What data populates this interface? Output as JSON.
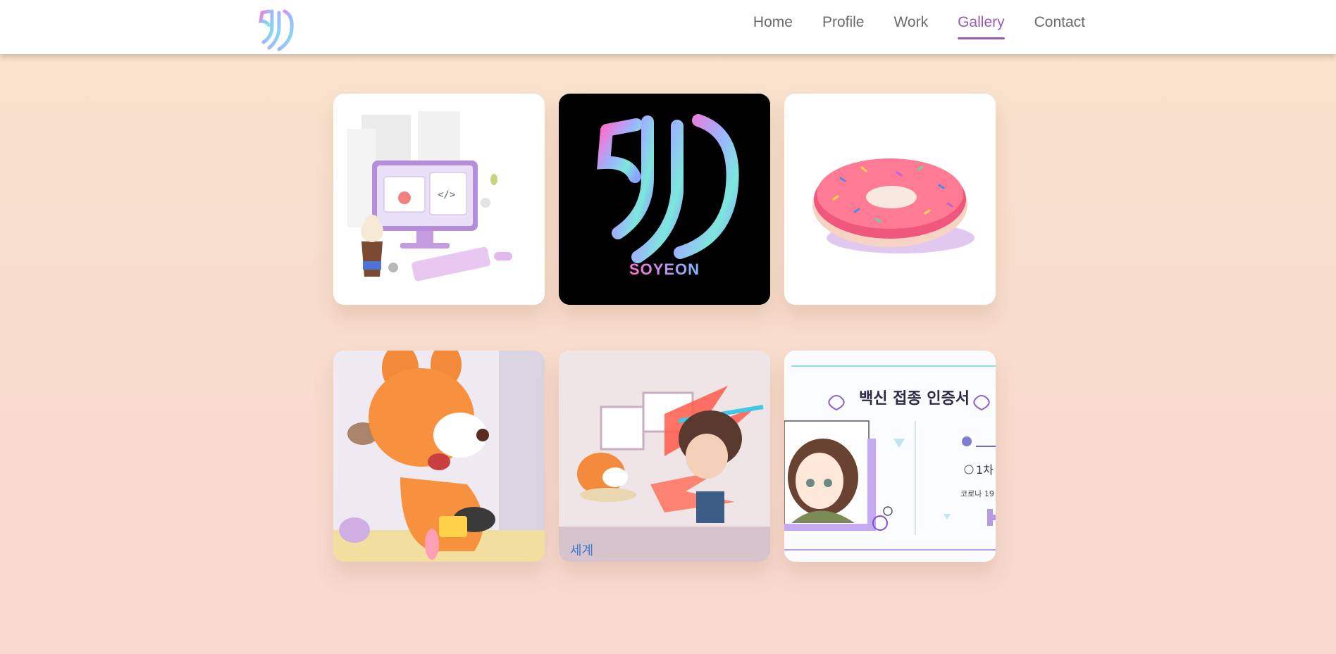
{
  "nav": {
    "items": [
      {
        "label": "Home"
      },
      {
        "label": "Profile"
      },
      {
        "label": "Work"
      },
      {
        "label": "Gallery",
        "active": true
      },
      {
        "label": "Contact"
      }
    ]
  },
  "gallery": {
    "tiles": [
      {
        "subject": "3d-desk-illustration"
      },
      {
        "subject": "syn-logo",
        "caption": "SOYEON"
      },
      {
        "subject": "donut-3d"
      },
      {
        "subject": "orange-deer-character"
      },
      {
        "subject": "animation-scene",
        "caption": "세계"
      },
      {
        "subject": "vaccine-certificate",
        "title": "백신 접종 인증서",
        "line1": "1차",
        "line2": "코로나 19"
      }
    ]
  },
  "colors": {
    "accent": "#9b59b6",
    "nav_text": "#6b6b6b",
    "background_top": "#f9e3cc",
    "background_bottom": "#f8d9cf"
  }
}
